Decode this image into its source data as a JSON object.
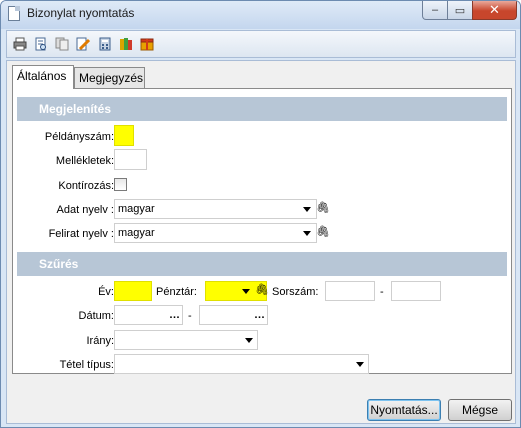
{
  "window": {
    "title": "Bizonylat nyomtatás"
  },
  "window_buttons": {
    "minimize": "–",
    "maximize": "▭",
    "close": "✕"
  },
  "toolbar": {
    "icons": [
      "printer-icon",
      "print-preview-icon",
      "copy-icon",
      "edit-icon",
      "calculator-icon",
      "books-icon",
      "package-icon"
    ]
  },
  "tabs": [
    {
      "label": "Általános",
      "active": true
    },
    {
      "label": "Megjegyzés",
      "active": false
    }
  ],
  "display_section": {
    "title": "Megjelenítés",
    "copies_label": "Példányszám:",
    "copies_value": "",
    "attachments_label": "Mellékletek:",
    "attachments_value": "",
    "posting_label": "Kontírozás:",
    "posting_checked": false,
    "data_lang_label": "Adat nyelv :",
    "data_lang_value": "magyar",
    "caption_lang_label": "Felirat nyelv :",
    "caption_lang_value": "magyar"
  },
  "filter_section": {
    "title": "Szűrés",
    "year_label": "Év:",
    "year_value": "",
    "cashbox_label": "Pénztár:",
    "cashbox_value": "",
    "serial_label": "Sorszám:",
    "serial_from": "",
    "serial_sep": "-",
    "serial_to": "",
    "date_label": "Dátum:",
    "date_from": "",
    "date_sep": "-",
    "date_to": "",
    "direction_label": "Irány:",
    "direction_value": "",
    "item_type_label": "Tétel típus:",
    "item_type_value": ""
  },
  "buttons": {
    "print": "Nyomtatás...",
    "cancel": "Mégse"
  },
  "colors": {
    "required_field": "#ffff00",
    "section_header": "#b7c6d6"
  }
}
